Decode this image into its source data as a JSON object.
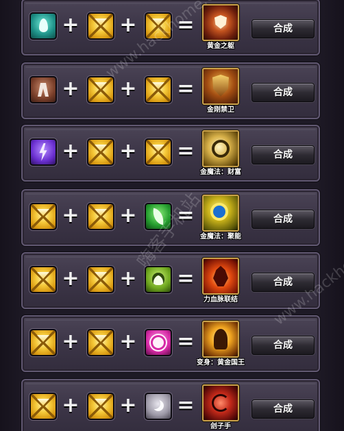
{
  "watermarks": [
    "www.hackhome.com",
    "嗨客手机站",
    "www.hackhome.com"
  ],
  "recipes": [
    {
      "ingredients": [
        {
          "icon": "teal-water-drop-icon",
          "color": "#1d8f86"
        },
        {
          "icon": "gold-crate-icon",
          "color": "#f5c93a"
        },
        {
          "icon": "gold-crate-icon",
          "color": "#f5c93a"
        }
      ],
      "result": {
        "name": "黄金之躯",
        "icon": "golden-body-rune-icon"
      },
      "button": "合成"
    },
    {
      "ingredients": [
        {
          "icon": "brown-armor-icon",
          "color": "#7a3f2a"
        },
        {
          "icon": "gold-crate-icon",
          "color": "#f5c93a"
        },
        {
          "icon": "gold-crate-icon",
          "color": "#f5c93a"
        }
      ],
      "result": {
        "name": "金刚禁卫",
        "icon": "golden-shield-icon"
      },
      "button": "合成"
    },
    {
      "ingredients": [
        {
          "icon": "purple-lightning-icon",
          "color": "#6a2fd0"
        },
        {
          "icon": "gold-crate-icon",
          "color": "#f5c93a"
        },
        {
          "icon": "gold-crate-icon",
          "color": "#f5c93a"
        }
      ],
      "result": {
        "name": "金魔法：财富",
        "icon": "gold-magic-wealth-icon"
      },
      "button": "合成"
    },
    {
      "ingredients": [
        {
          "icon": "gold-crate-icon",
          "color": "#f5c93a"
        },
        {
          "icon": "gold-crate-icon",
          "color": "#f5c93a"
        },
        {
          "icon": "green-leaf-icon",
          "color": "#249c2e"
        }
      ],
      "result": {
        "name": "金魔法：聚能",
        "icon": "gold-magic-gather-icon"
      },
      "button": "合成"
    },
    {
      "ingredients": [
        {
          "icon": "gold-crate-icon",
          "color": "#f5c93a"
        },
        {
          "icon": "gold-crate-icon",
          "color": "#f5c93a"
        },
        {
          "icon": "lime-skull-icon",
          "color": "#6ea61e"
        }
      ],
      "result": {
        "name": "力血脉联结",
        "icon": "blood-link-icon"
      },
      "button": "合成"
    },
    {
      "ingredients": [
        {
          "icon": "gold-crate-icon",
          "color": "#f5c93a"
        },
        {
          "icon": "gold-crate-icon",
          "color": "#f5c93a"
        },
        {
          "icon": "pink-star-icon",
          "color": "#d62aa6"
        }
      ],
      "result": {
        "name": "变身：黄金国王",
        "icon": "golden-king-icon"
      },
      "button": "合成"
    },
    {
      "ingredients": [
        {
          "icon": "gold-crate-icon",
          "color": "#f5c93a"
        },
        {
          "icon": "gold-crate-icon",
          "color": "#f5c93a"
        },
        {
          "icon": "gray-moon-icon",
          "color": "#9c98a6"
        }
      ],
      "result": {
        "name": "刽子手",
        "icon": "executioner-icon"
      },
      "button": "合成"
    }
  ]
}
